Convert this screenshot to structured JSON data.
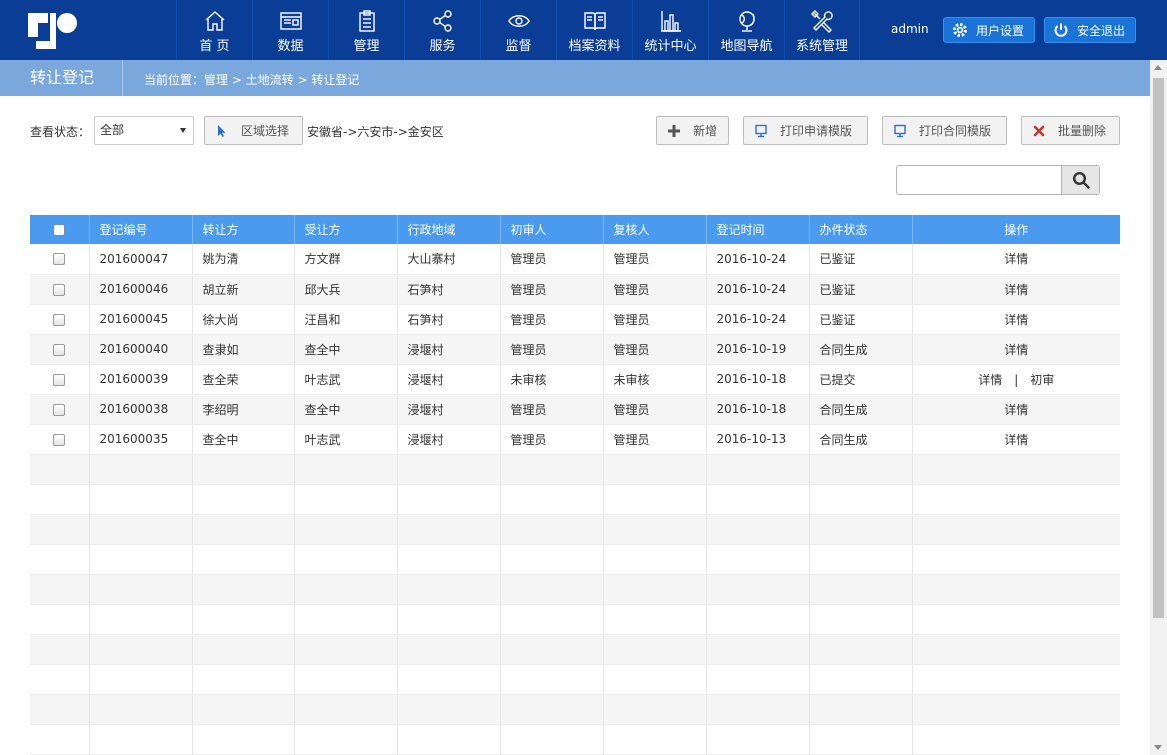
{
  "topbar": {
    "nav": [
      {
        "label": "首 页",
        "icon": "home-icon"
      },
      {
        "label": "数据",
        "icon": "data-icon"
      },
      {
        "label": "管理",
        "icon": "clipboard-icon"
      },
      {
        "label": "服务",
        "icon": "share-icon"
      },
      {
        "label": "监督",
        "icon": "eye-icon"
      },
      {
        "label": "档案资料",
        "icon": "book-icon"
      },
      {
        "label": "统计中心",
        "icon": "bar-chart-icon"
      },
      {
        "label": "地图导航",
        "icon": "globe-icon"
      },
      {
        "label": "系统管理",
        "icon": "tools-icon"
      }
    ],
    "user": "admin",
    "settings_label": "用户设置",
    "logout_label": "安全退出",
    "accent": "#0a3d96"
  },
  "crumbbar": {
    "title": "转让登记",
    "path": "当前位置：管理 > 土地流转 > 转让登记"
  },
  "toolbar": {
    "status_label": "查看状态：",
    "status_value": "全部",
    "region_button": "区域选择",
    "region_text": "安徽省->六安市->金安区",
    "add_label": "新增",
    "print_apply_label": "打印申请模版",
    "print_contract_label": "打印合同模版",
    "batch_delete_label": "批量删除",
    "search_value": ""
  },
  "table": {
    "headers": [
      "登记编号",
      "转让方",
      "受让方",
      "行政地域",
      "初审人",
      "复核人",
      "登记时间",
      "办件状态",
      "操作"
    ],
    "rows": [
      {
        "id": "201600047",
        "from": "姚为清",
        "to": "方文群",
        "area": "大山寨村",
        "first": "管理员",
        "review": "管理员",
        "date": "2016-10-24",
        "status": "已鉴证",
        "op1": "详情",
        "op2": ""
      },
      {
        "id": "201600046",
        "from": "胡立新",
        "to": "邱大兵",
        "area": "石笋村",
        "first": "管理员",
        "review": "管理员",
        "date": "2016-10-24",
        "status": "已鉴证",
        "op1": "详情",
        "op2": ""
      },
      {
        "id": "201600045",
        "from": "徐大尚",
        "to": "汪昌和",
        "area": "石笋村",
        "first": "管理员",
        "review": "管理员",
        "date": "2016-10-24",
        "status": "已鉴证",
        "op1": "详情",
        "op2": ""
      },
      {
        "id": "201600040",
        "from": "查隶如",
        "to": "查全中",
        "area": "浸堰村",
        "first": "管理员",
        "review": "管理员",
        "date": "2016-10-19",
        "status": "合同生成",
        "op1": "详情",
        "op2": ""
      },
      {
        "id": "201600039",
        "from": "查全荣",
        "to": "叶志武",
        "area": "浸堰村",
        "first": "未审核",
        "review": "未审核",
        "date": "2016-10-18",
        "status": "已提交",
        "op1": "详情",
        "op2": "初审"
      },
      {
        "id": "201600038",
        "from": "李绍明",
        "to": "查全中",
        "area": "浸堰村",
        "first": "管理员",
        "review": "管理员",
        "date": "2016-10-18",
        "status": "合同生成",
        "op1": "详情",
        "op2": ""
      },
      {
        "id": "201600035",
        "from": "查全中",
        "to": "叶志武",
        "area": "浸堰村",
        "first": "管理员",
        "review": "管理员",
        "date": "2016-10-13",
        "status": "合同生成",
        "op1": "详情",
        "op2": ""
      }
    ],
    "empty_rows": 10
  }
}
